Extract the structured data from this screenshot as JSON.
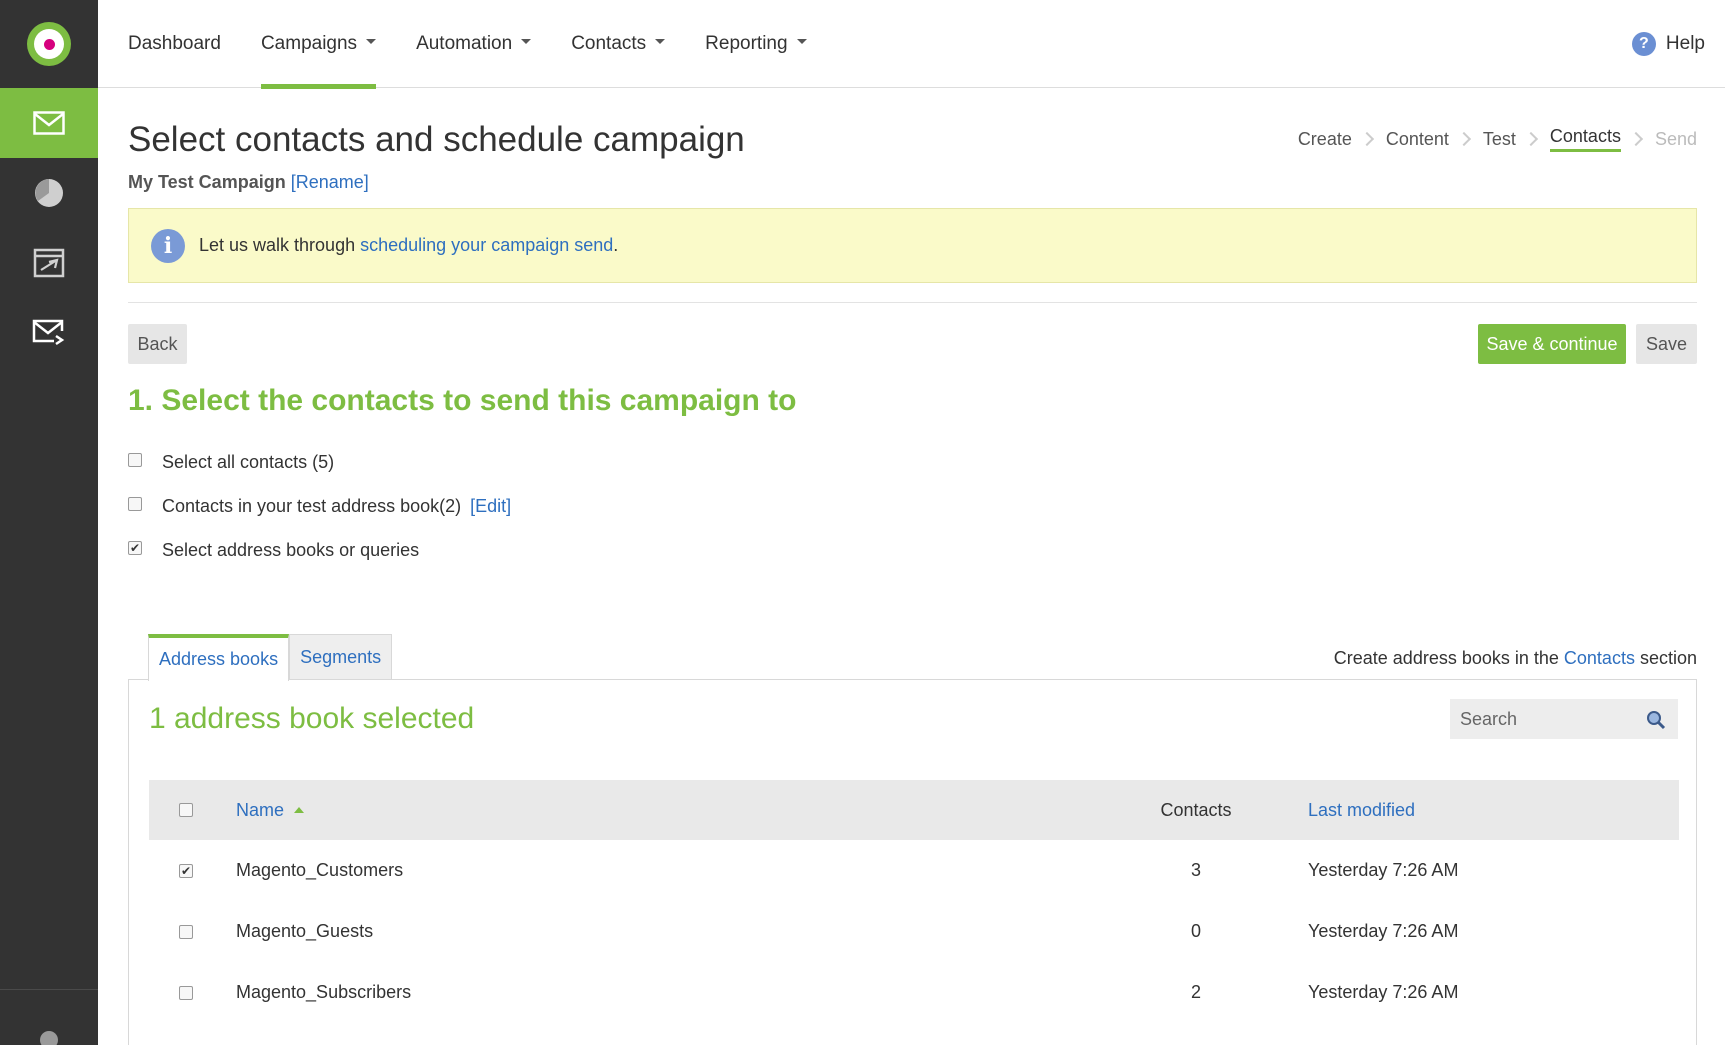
{
  "topnav": {
    "items": [
      {
        "label": "Dashboard"
      },
      {
        "label": "Campaigns"
      },
      {
        "label": "Automation"
      },
      {
        "label": "Contacts"
      },
      {
        "label": "Reporting"
      }
    ],
    "help_label": "Help"
  },
  "sidebar": {
    "items": [
      "mail-icon",
      "pie-chart-icon",
      "automation-icon",
      "email-send-icon"
    ]
  },
  "page": {
    "title": "Select contacts and schedule campaign",
    "campaign_name": "My Test Campaign",
    "rename_label": "[Rename]"
  },
  "steps": [
    "Create",
    "Content",
    "Test",
    "Contacts",
    "Send"
  ],
  "info": {
    "prefix": "Let us walk through ",
    "link": "scheduling your campaign send",
    "suffix": "."
  },
  "buttons": {
    "back": "Back",
    "save_continue": "Save & continue",
    "save": "Save"
  },
  "section": {
    "title": "1. Select the contacts to send this campaign to",
    "options": [
      {
        "label": "Select all contacts (5)",
        "checked": false
      },
      {
        "label": "Contacts in your test address book(2)",
        "edit": "[Edit]",
        "checked": false
      },
      {
        "label": "Select address books or queries",
        "checked": true
      }
    ]
  },
  "tabs": {
    "items": [
      "Address books",
      "Segments"
    ],
    "note_prefix": "Create address books in the ",
    "note_link": "Contacts",
    "note_suffix": " section"
  },
  "panel": {
    "title": "1 address book selected",
    "search_placeholder": "Search"
  },
  "table": {
    "headers": {
      "name": "Name",
      "contacts": "Contacts",
      "last_modified": "Last modified"
    },
    "rows": [
      {
        "name": "Magento_Customers",
        "contacts": "3",
        "modified": "Yesterday 7:26 AM",
        "checked": true
      },
      {
        "name": "Magento_Guests",
        "contacts": "0",
        "modified": "Yesterday 7:26 AM",
        "checked": false
      },
      {
        "name": "Magento_Subscribers",
        "contacts": "2",
        "modified": "Yesterday 7:26 AM",
        "checked": false
      }
    ]
  },
  "colors": {
    "accent": "#7dbd42",
    "link": "#2e6fbf",
    "sidebar": "#333333"
  }
}
